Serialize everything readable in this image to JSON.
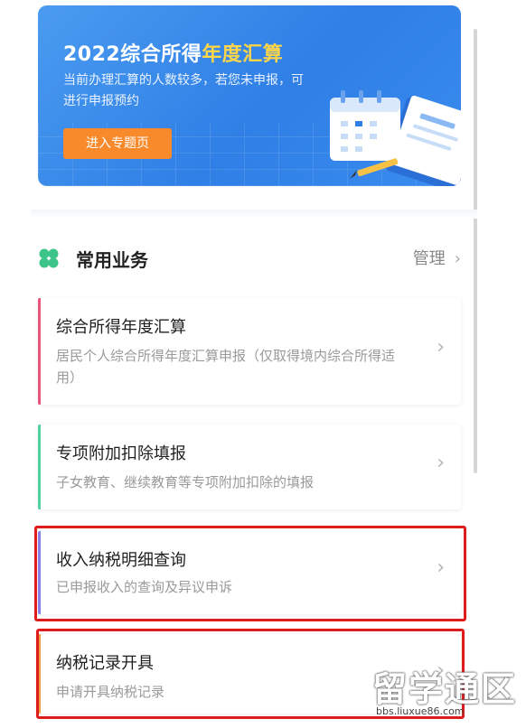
{
  "banner": {
    "title_prefix": "2022综合所得",
    "title_highlight": "年度汇算",
    "description": "当前办理汇算的人数较多，若您未申报，可进行申报预约",
    "button": "进入专题页",
    "illustration": "calendar-document-icon"
  },
  "section": {
    "icon": "clover-icon",
    "title": "常用业务",
    "manage": "管理",
    "chevron": "›"
  },
  "cards": [
    {
      "title": "综合所得年度汇算",
      "description": "居民个人综合所得年度汇算申报（仅取得境内综合所得适用）",
      "accent": "#e8557a",
      "chevron": "›"
    },
    {
      "title": "专项附加扣除填报",
      "description": "子女教育、继续教育等专项附加扣除的填报",
      "accent": "#4fd1a0",
      "chevron": "›"
    },
    {
      "title": "收入纳税明细查询",
      "description": "已申报收入的查询及异议申诉",
      "accent": "#8a7de8",
      "chevron": "›"
    },
    {
      "title": "纳税记录开具",
      "description": "申请开具纳税记录",
      "accent": "#f0a040",
      "chevron": "›"
    }
  ],
  "colors": {
    "highlight_border": "#e01b1b",
    "banner_blue": "#3a8cee",
    "button_orange": "#f88a2c"
  },
  "watermark": {
    "main": "留学通区",
    "sub": "bbs.liuxue86.com"
  }
}
